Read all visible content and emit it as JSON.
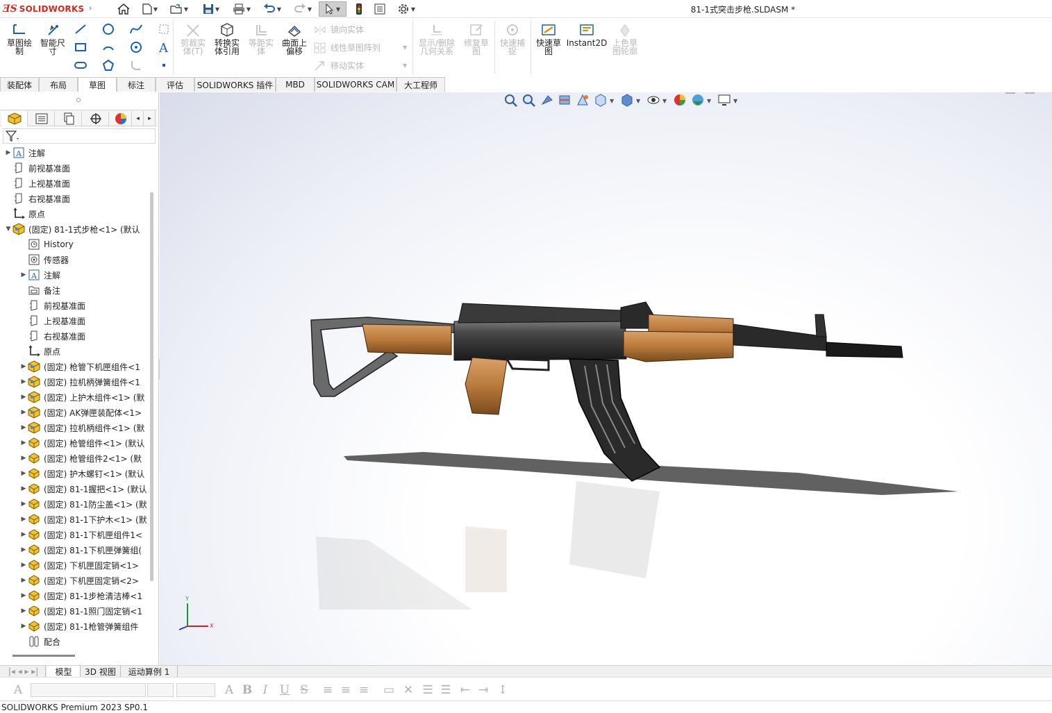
{
  "app": {
    "logo_text": "SOLIDWORKS",
    "document_title": "81-1式突击步枪.SLDASM *"
  },
  "commands": {
    "sketch": "草图绘\n制",
    "smart_dimension": "智能尺\n寸",
    "trim": "剪裁实\n体(T)",
    "convert": "转换实\n体引用",
    "offset": "等距实\n体",
    "surface_offset": "曲面上\n偏移",
    "mirror": "镜向实体",
    "linear_pattern": "线性草图阵列",
    "move": "移动实体",
    "display_delete": "显示/删除\n几何关系",
    "repair": "修复草\n图",
    "quick_snap": "快速捕\n捉",
    "rapid_sketch": "快速草\n图",
    "instant2d": "Instant2D",
    "shaded_contours": "上色草\n图轮廓"
  },
  "tabs": [
    "装配体",
    "布局",
    "草图",
    "标注",
    "评估",
    "SOLIDWORKS 插件",
    "MBD",
    "SOLIDWORKS CAM",
    "大工程师"
  ],
  "active_tab": "草图",
  "tree": [
    {
      "label": "注解",
      "level": 0,
      "expand": "▶",
      "icon": "annotation-icon"
    },
    {
      "label": "前视基准面",
      "level": 0,
      "expand": "",
      "icon": "plane-icon"
    },
    {
      "label": "上视基准面",
      "level": 0,
      "expand": "",
      "icon": "plane-icon"
    },
    {
      "label": "右视基准面",
      "level": 0,
      "expand": "",
      "icon": "plane-icon"
    },
    {
      "label": "原点",
      "level": 0,
      "expand": "",
      "icon": "origin-icon"
    },
    {
      "label": "(固定) 81-1式步枪<1> (默认",
      "level": 0,
      "expand": "▼",
      "icon": "subassembly-icon"
    },
    {
      "label": "History",
      "level": 1,
      "expand": "",
      "icon": "history-icon"
    },
    {
      "label": "传感器",
      "level": 1,
      "expand": "",
      "icon": "sensor-icon"
    },
    {
      "label": "注解",
      "level": 1,
      "expand": "▶",
      "icon": "annotation-icon"
    },
    {
      "label": "备注",
      "level": 1,
      "expand": "",
      "icon": "notes-icon"
    },
    {
      "label": "前视基准面",
      "level": 1,
      "expand": "",
      "icon": "plane-icon"
    },
    {
      "label": "上视基准面",
      "level": 1,
      "expand": "",
      "icon": "plane-icon"
    },
    {
      "label": "右视基准面",
      "level": 1,
      "expand": "",
      "icon": "plane-icon"
    },
    {
      "label": "原点",
      "level": 1,
      "expand": "",
      "icon": "origin-icon"
    },
    {
      "label": "(固定) 枪管下机匣组件<1",
      "level": 1,
      "expand": "▶",
      "icon": "subassembly-icon"
    },
    {
      "label": "(固定) 拉机柄弹簧组件<1",
      "level": 1,
      "expand": "▶",
      "icon": "subassembly-icon"
    },
    {
      "label": "(固定) 上护木组件<1> (默",
      "level": 1,
      "expand": "▶",
      "icon": "subassembly-icon"
    },
    {
      "label": "(固定) AK弹匣装配体<1>",
      "level": 1,
      "expand": "▶",
      "icon": "subassembly-icon"
    },
    {
      "label": "(固定) 拉机柄组件<1> (默",
      "level": 1,
      "expand": "▶",
      "icon": "subassembly-icon"
    },
    {
      "label": "(固定) 枪管组件<1> (默认",
      "level": 1,
      "expand": "▶",
      "icon": "part-icon"
    },
    {
      "label": "(固定) 枪管组件2<1> (默",
      "level": 1,
      "expand": "▶",
      "icon": "part-icon"
    },
    {
      "label": "(固定) 护木螺钉<1> (默认",
      "level": 1,
      "expand": "▶",
      "icon": "part-icon"
    },
    {
      "label": "(固定) 81-1握把<1> (默认",
      "level": 1,
      "expand": "▶",
      "icon": "part-icon"
    },
    {
      "label": "(固定) 81-1防尘盖<1> (默",
      "level": 1,
      "expand": "▶",
      "icon": "part-icon"
    },
    {
      "label": "(固定) 81-1下护木<1> (默",
      "level": 1,
      "expand": "▶",
      "icon": "part-icon"
    },
    {
      "label": "(固定) 81-1下机匣组件1<",
      "level": 1,
      "expand": "▶",
      "icon": "part-icon"
    },
    {
      "label": "(固定) 81-1下机匣弹簧组(",
      "level": 1,
      "expand": "▶",
      "icon": "part-icon"
    },
    {
      "label": "(固定) 下机匣固定销<1>",
      "level": 1,
      "expand": "▶",
      "icon": "part-icon"
    },
    {
      "label": "(固定) 下机匣固定销<2>",
      "level": 1,
      "expand": "▶",
      "icon": "part-icon"
    },
    {
      "label": "(固定) 81-1步枪清洁棒<1",
      "level": 1,
      "expand": "▶",
      "icon": "part-icon"
    },
    {
      "label": "(固定) 81-1照门固定销<1",
      "level": 1,
      "expand": "▶",
      "icon": "part-icon"
    },
    {
      "label": "(固定) 81-1枪管弹簧组件",
      "level": 1,
      "expand": "▶",
      "icon": "part-icon"
    },
    {
      "label": "配合",
      "level": 1,
      "expand": "",
      "icon": "mates-icon"
    }
  ],
  "bottom_tabs": [
    "模型",
    "3D 视图",
    "运动算例 1"
  ],
  "active_bottom_tab": "模型",
  "triad": {
    "x": "X",
    "y": "Y"
  },
  "status": "SOLIDWORKS Premium 2023 SP0.1"
}
